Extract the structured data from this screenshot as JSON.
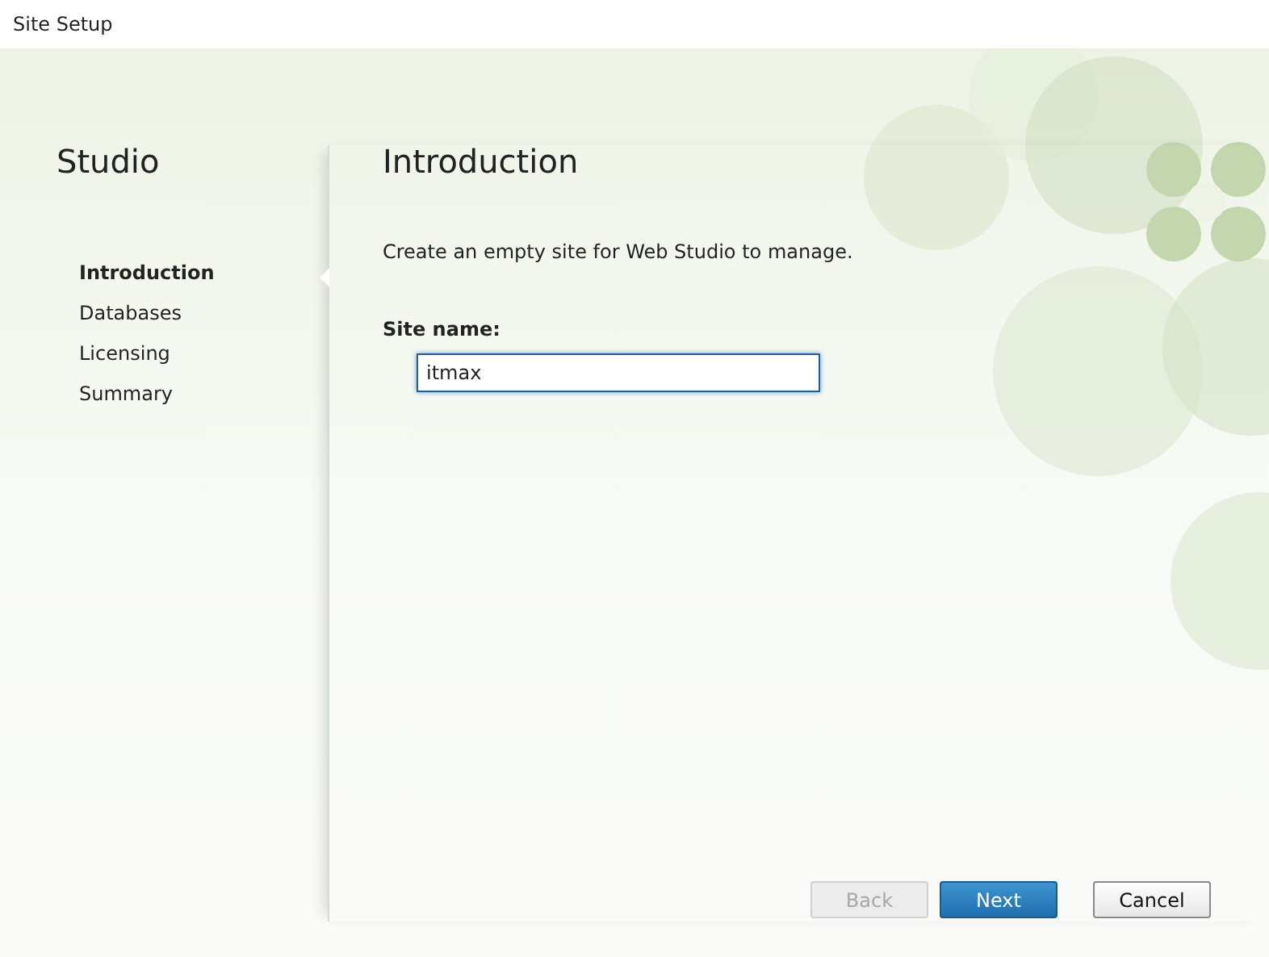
{
  "window": {
    "title": "Site Setup"
  },
  "sidebar": {
    "title": "Studio",
    "items": [
      {
        "label": "Introduction",
        "selected": true
      },
      {
        "label": "Databases",
        "selected": false
      },
      {
        "label": "Licensing",
        "selected": false
      },
      {
        "label": "Summary",
        "selected": false
      }
    ]
  },
  "page": {
    "heading": "Introduction",
    "description": "Create an empty site for Web Studio to manage.",
    "field": {
      "label": "Site name:",
      "value": "itmax",
      "focused": true
    }
  },
  "buttons": [
    {
      "label": "Back",
      "disabled": true,
      "primary": false
    },
    {
      "label": "Next",
      "disabled": false,
      "primary": true
    },
    {
      "label": "Cancel",
      "disabled": false,
      "primary": false
    }
  ]
}
